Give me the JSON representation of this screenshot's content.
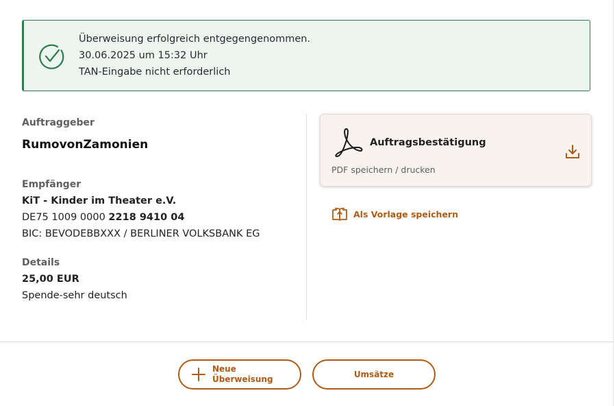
{
  "success_banner": {
    "message": "Überweisung erfolgreich entgegengenommen.",
    "timestamp": "30.06.2025 um 15:32 Uhr",
    "tan_note": "TAN-Eingabe nicht erforderlich",
    "icon": "check-circle-icon",
    "color": "#2e7d4b"
  },
  "auftraggeber": {
    "label": "Auftraggeber",
    "name": "RumovonZamonien"
  },
  "empfaenger": {
    "label": "Empfänger",
    "name": "KiT - Kinder im Theater e.V.",
    "iban_prefix": "DE75 1009 0000",
    "iban_suffix": "2218 9410 04",
    "bic_line": "BIC: BEVODEBBXXX / BERLINER VOLKSBANK EG"
  },
  "details": {
    "label": "Details",
    "amount": "25,00 EUR",
    "purpose": "Spende-sehr deutsch"
  },
  "pdf_card": {
    "title": "Auftragsbestätigung",
    "subtitle": "PDF speichern / drucken",
    "icon": "pdf-icon",
    "action_icon": "download-icon"
  },
  "template_link": {
    "label": "Als Vorlage speichern",
    "icon": "book-upload-icon"
  },
  "buttons": {
    "new_transfer": "Neue\nÜberweisung",
    "transactions": "Umsätze"
  },
  "colors": {
    "accent": "#b25a12",
    "success": "#2e7d4b",
    "success_bg": "#ecf5ef",
    "card_bg": "#f8f3ee"
  }
}
